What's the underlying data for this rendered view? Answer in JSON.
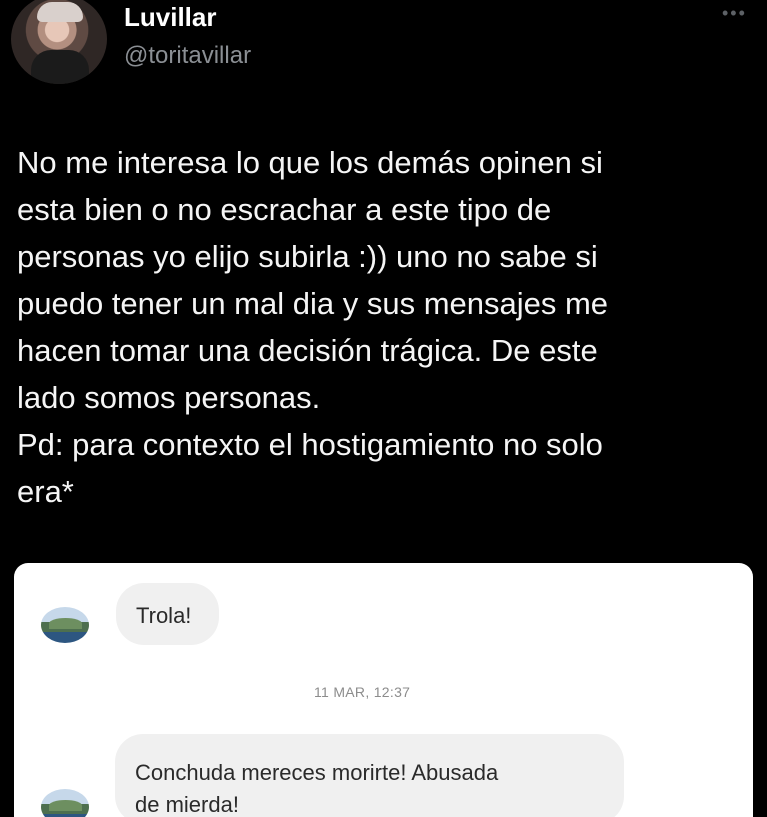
{
  "author": {
    "display_name": "Luvillar",
    "handle": "@toritavillar"
  },
  "tweet": {
    "lines": [
      "No me interesa lo que los demás opinen si",
      "esta bien o no escrachar a este tipo de",
      "personas yo elijo subirla :)) uno no sabe si",
      "puedo tener un mal dia y sus mensajes me",
      "hacen tomar una decisión trágica. De este",
      "lado somos personas.",
      "Pd: para contexto el hostigamiento no solo",
      "era*"
    ]
  },
  "screenshot_embed": {
    "messages": [
      {
        "text": "Trola!"
      },
      {
        "timestamp": "11 MAR, 12:37"
      },
      {
        "line1": "Conchuda mereces morirte! Abusada",
        "line2": "de mierda!"
      }
    ]
  },
  "icons": {
    "more": "more-options-icon",
    "avatar": "profile-avatar",
    "sender_avatar": "sender-avatar"
  },
  "colors": {
    "background": "#000000",
    "text_primary": "#f5f5f5",
    "text_secondary": "#8b8f94",
    "card_background": "#ffffff",
    "bubble_background": "#f0f0f0"
  }
}
